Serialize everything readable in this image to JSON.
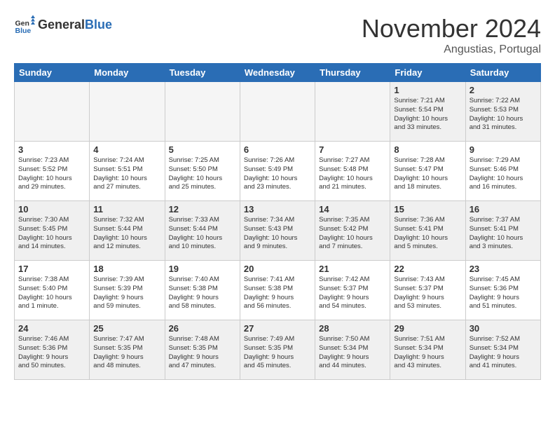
{
  "header": {
    "logo_general": "General",
    "logo_blue": "Blue",
    "month": "November 2024",
    "location": "Angustias, Portugal"
  },
  "weekdays": [
    "Sunday",
    "Monday",
    "Tuesday",
    "Wednesday",
    "Thursday",
    "Friday",
    "Saturday"
  ],
  "weeks": [
    [
      {
        "day": "",
        "info": ""
      },
      {
        "day": "",
        "info": ""
      },
      {
        "day": "",
        "info": ""
      },
      {
        "day": "",
        "info": ""
      },
      {
        "day": "",
        "info": ""
      },
      {
        "day": "1",
        "info": "Sunrise: 7:21 AM\nSunset: 5:54 PM\nDaylight: 10 hours\nand 33 minutes."
      },
      {
        "day": "2",
        "info": "Sunrise: 7:22 AM\nSunset: 5:53 PM\nDaylight: 10 hours\nand 31 minutes."
      }
    ],
    [
      {
        "day": "3",
        "info": "Sunrise: 7:23 AM\nSunset: 5:52 PM\nDaylight: 10 hours\nand 29 minutes."
      },
      {
        "day": "4",
        "info": "Sunrise: 7:24 AM\nSunset: 5:51 PM\nDaylight: 10 hours\nand 27 minutes."
      },
      {
        "day": "5",
        "info": "Sunrise: 7:25 AM\nSunset: 5:50 PM\nDaylight: 10 hours\nand 25 minutes."
      },
      {
        "day": "6",
        "info": "Sunrise: 7:26 AM\nSunset: 5:49 PM\nDaylight: 10 hours\nand 23 minutes."
      },
      {
        "day": "7",
        "info": "Sunrise: 7:27 AM\nSunset: 5:48 PM\nDaylight: 10 hours\nand 21 minutes."
      },
      {
        "day": "8",
        "info": "Sunrise: 7:28 AM\nSunset: 5:47 PM\nDaylight: 10 hours\nand 18 minutes."
      },
      {
        "day": "9",
        "info": "Sunrise: 7:29 AM\nSunset: 5:46 PM\nDaylight: 10 hours\nand 16 minutes."
      }
    ],
    [
      {
        "day": "10",
        "info": "Sunrise: 7:30 AM\nSunset: 5:45 PM\nDaylight: 10 hours\nand 14 minutes."
      },
      {
        "day": "11",
        "info": "Sunrise: 7:32 AM\nSunset: 5:44 PM\nDaylight: 10 hours\nand 12 minutes."
      },
      {
        "day": "12",
        "info": "Sunrise: 7:33 AM\nSunset: 5:44 PM\nDaylight: 10 hours\nand 10 minutes."
      },
      {
        "day": "13",
        "info": "Sunrise: 7:34 AM\nSunset: 5:43 PM\nDaylight: 10 hours\nand 9 minutes."
      },
      {
        "day": "14",
        "info": "Sunrise: 7:35 AM\nSunset: 5:42 PM\nDaylight: 10 hours\nand 7 minutes."
      },
      {
        "day": "15",
        "info": "Sunrise: 7:36 AM\nSunset: 5:41 PM\nDaylight: 10 hours\nand 5 minutes."
      },
      {
        "day": "16",
        "info": "Sunrise: 7:37 AM\nSunset: 5:41 PM\nDaylight: 10 hours\nand 3 minutes."
      }
    ],
    [
      {
        "day": "17",
        "info": "Sunrise: 7:38 AM\nSunset: 5:40 PM\nDaylight: 10 hours\nand 1 minute."
      },
      {
        "day": "18",
        "info": "Sunrise: 7:39 AM\nSunset: 5:39 PM\nDaylight: 9 hours\nand 59 minutes."
      },
      {
        "day": "19",
        "info": "Sunrise: 7:40 AM\nSunset: 5:38 PM\nDaylight: 9 hours\nand 58 minutes."
      },
      {
        "day": "20",
        "info": "Sunrise: 7:41 AM\nSunset: 5:38 PM\nDaylight: 9 hours\nand 56 minutes."
      },
      {
        "day": "21",
        "info": "Sunrise: 7:42 AM\nSunset: 5:37 PM\nDaylight: 9 hours\nand 54 minutes."
      },
      {
        "day": "22",
        "info": "Sunrise: 7:43 AM\nSunset: 5:37 PM\nDaylight: 9 hours\nand 53 minutes."
      },
      {
        "day": "23",
        "info": "Sunrise: 7:45 AM\nSunset: 5:36 PM\nDaylight: 9 hours\nand 51 minutes."
      }
    ],
    [
      {
        "day": "24",
        "info": "Sunrise: 7:46 AM\nSunset: 5:36 PM\nDaylight: 9 hours\nand 50 minutes."
      },
      {
        "day": "25",
        "info": "Sunrise: 7:47 AM\nSunset: 5:35 PM\nDaylight: 9 hours\nand 48 minutes."
      },
      {
        "day": "26",
        "info": "Sunrise: 7:48 AM\nSunset: 5:35 PM\nDaylight: 9 hours\nand 47 minutes."
      },
      {
        "day": "27",
        "info": "Sunrise: 7:49 AM\nSunset: 5:35 PM\nDaylight: 9 hours\nand 45 minutes."
      },
      {
        "day": "28",
        "info": "Sunrise: 7:50 AM\nSunset: 5:34 PM\nDaylight: 9 hours\nand 44 minutes."
      },
      {
        "day": "29",
        "info": "Sunrise: 7:51 AM\nSunset: 5:34 PM\nDaylight: 9 hours\nand 43 minutes."
      },
      {
        "day": "30",
        "info": "Sunrise: 7:52 AM\nSunset: 5:34 PM\nDaylight: 9 hours\nand 41 minutes."
      }
    ]
  ]
}
